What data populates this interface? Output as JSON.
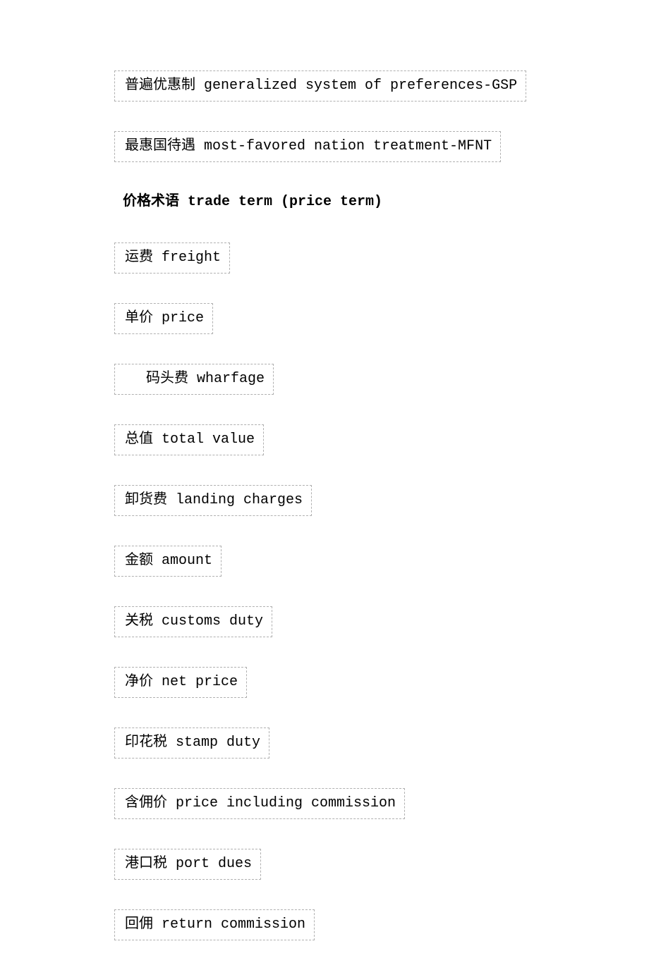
{
  "terms_top": [
    "普遍优惠制 generalized system of preferences-GSP",
    "最惠国待遇 most-favored nation treatment-MFNT"
  ],
  "heading": "价格术语 trade term (price term)",
  "terms_price": [
    {
      "text": "运费 freight",
      "indent": false
    },
    {
      "text": "单价 price",
      "indent": false
    },
    {
      "text": "码头费 wharfage",
      "indent": true
    },
    {
      "text": "总值 total value",
      "indent": false
    },
    {
      "text": "卸货费 landing charges",
      "indent": false
    },
    {
      "text": "金额 amount",
      "indent": false
    },
    {
      "text": "关税 customs duty",
      "indent": false
    },
    {
      "text": "净价 net price",
      "indent": false
    },
    {
      "text": "印花税 stamp duty",
      "indent": false
    },
    {
      "text": "含佣价 price including commission",
      "indent": false
    },
    {
      "text": "港口税 port dues",
      "indent": false
    },
    {
      "text": "回佣 return commission",
      "indent": false
    }
  ]
}
